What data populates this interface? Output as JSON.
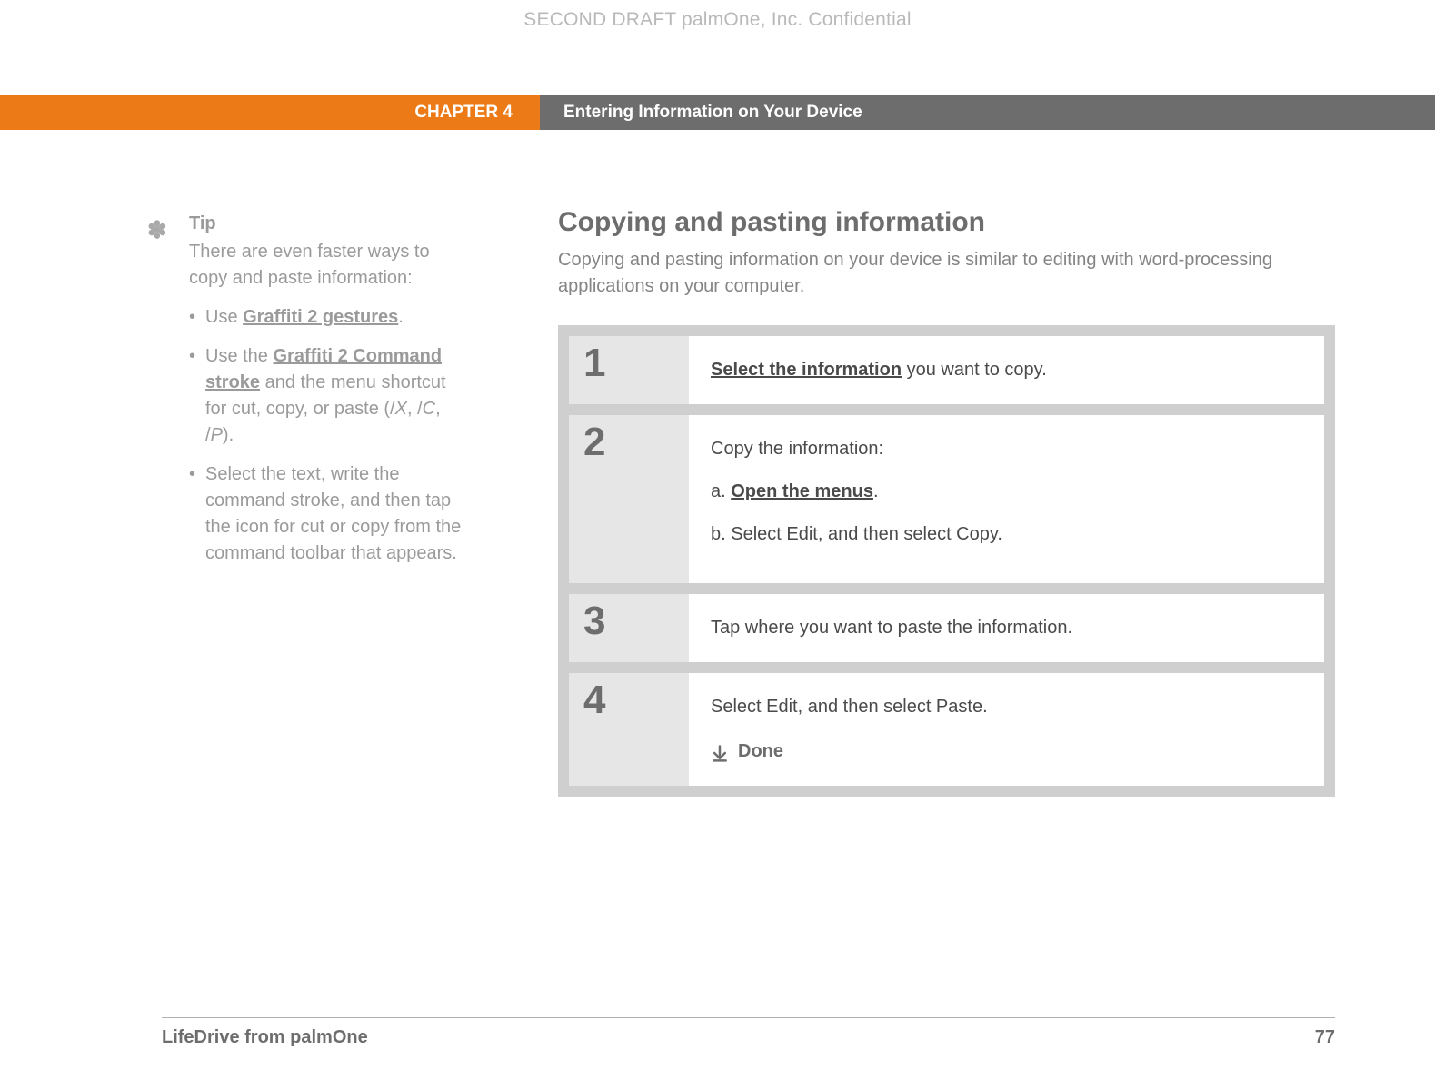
{
  "watermark": "SECOND DRAFT palmOne, Inc.  Confidential",
  "header": {
    "chapter": "CHAPTER 4",
    "title": "Entering Information on Your Device"
  },
  "sidebar_tip": {
    "heading": "Tip",
    "intro": "There are even faster ways to copy and paste information:",
    "b1": {
      "pre": "Use ",
      "link": "Graffiti 2 gestures",
      "post": "."
    },
    "b2": {
      "pre": "Use the ",
      "link": "Graffiti 2 Command stroke",
      "post1": " and the menu shortcut for cut, copy, or paste (/",
      "x": "X",
      "sep1": ", /",
      "c": "C",
      "sep2": ", /",
      "p": "P",
      "post2": ")."
    },
    "b3": "Select the text, write the command stroke, and then tap the icon for cut or copy from the command toolbar that appears."
  },
  "main": {
    "title": "Copying and pasting information",
    "intro": "Copying and pasting information on your device is similar to editing with word-processing applications on your computer."
  },
  "steps": {
    "s1": {
      "num": "1",
      "link": "Select the information",
      "post": " you want to copy."
    },
    "s2": {
      "num": "2",
      "line": "Copy the information:",
      "a_label": "a.  ",
      "a_link": "Open the menus",
      "a_post": ".",
      "b_label": "b.  ",
      "b_text": "Select Edit, and then select Copy."
    },
    "s3": {
      "num": "3",
      "text": "Tap where you want to paste the information."
    },
    "s4": {
      "num": "4",
      "text": "Select Edit, and then select Paste.",
      "done": "Done"
    }
  },
  "footer": {
    "product": "LifeDrive from palmOne",
    "page": "77"
  }
}
